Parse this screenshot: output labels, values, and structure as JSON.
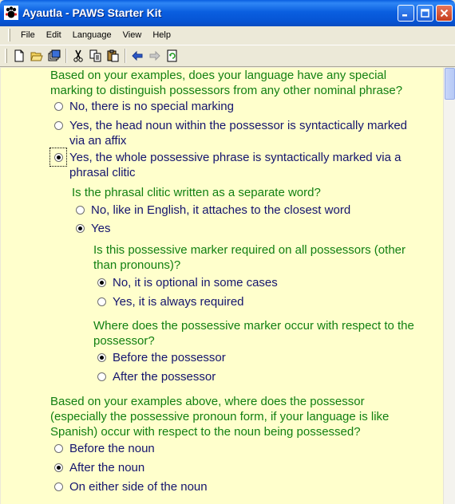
{
  "window": {
    "title": "Ayautla - PAWS Starter Kit"
  },
  "menu": {
    "file": "File",
    "edit": "Edit",
    "language": "Language",
    "view": "View",
    "help": "Help"
  },
  "toolbar": {
    "icons": [
      "new-document-icon",
      "open-folder-icon",
      "windows-icon",
      "cut-icon",
      "copy-icon",
      "paste-icon",
      "back-arrow-icon",
      "forward-arrow-icon",
      "refresh-icon"
    ]
  },
  "colors": {
    "question": "#128012",
    "option": "#14146e",
    "background": "#ffffcc"
  },
  "questions": {
    "q1": {
      "text_l1": "Based on your examples, does your language have any special",
      "text_l2": "marking to distinguish possessors from any other nominal phrase?",
      "opt1": "No, there is no special marking",
      "opt2_l1": "Yes, the head noun within the possessor is syntactically marked",
      "opt2_l2": "via an affix",
      "opt3_l1": "Yes, the whole possessive phrase is syntactically marked via a",
      "opt3_l2": "phrasal clitic",
      "selected": "opt3"
    },
    "q2": {
      "text": "Is the phrasal clitic written as a separate word?",
      "opt1": "No, like in English, it attaches to the closest word",
      "opt2": "Yes",
      "selected": "opt2"
    },
    "q3": {
      "text_l1": "Is this possessive marker required on all possessors (other",
      "text_l2": "than pronouns)?",
      "opt1": "No, it is optional in some cases",
      "opt2": "Yes, it is always required",
      "selected": "opt1"
    },
    "q4": {
      "text_l1": "Where does the possessive marker occur with respect to the",
      "text_l2": "possessor?",
      "opt1": "Before the possessor",
      "opt2": "After the possessor",
      "selected": "opt1"
    },
    "q5": {
      "text_l1": "Based on your examples above, where does the possessor",
      "text_l2": "(especially the possessive pronoun form, if your language is like",
      "text_l3": "Spanish) occur with respect to the noun being possessed?",
      "opt1": "Before the noun",
      "opt2": "After the noun",
      "opt3": "On either side of the noun",
      "selected": "opt2"
    }
  }
}
